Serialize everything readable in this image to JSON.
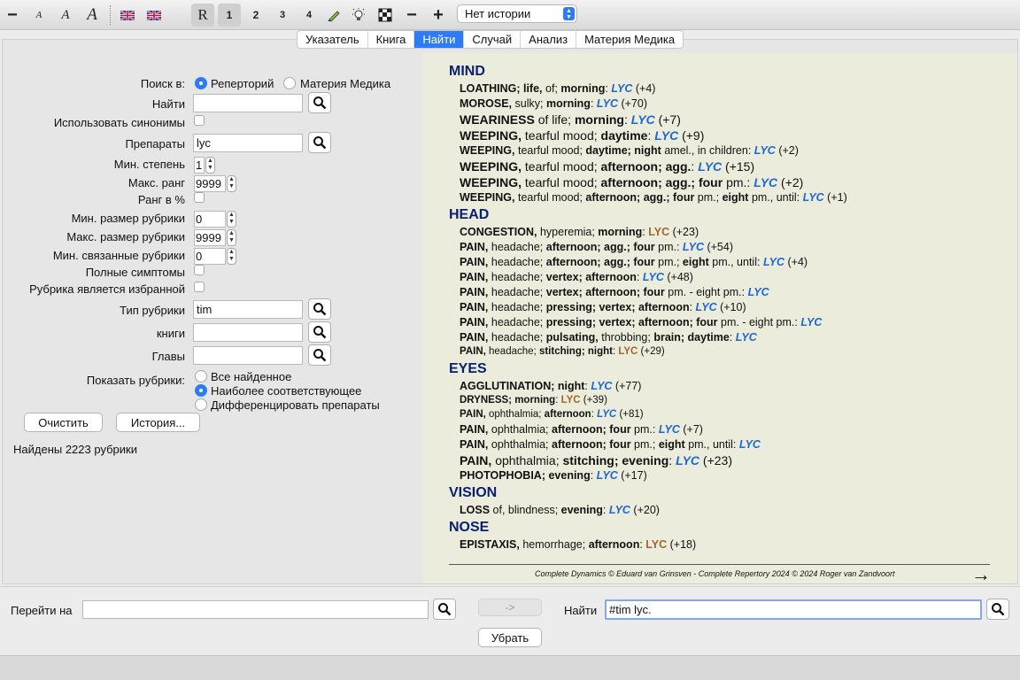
{
  "toolbar": {
    "font_buttons": [
      "−",
      "A",
      "A",
      "A"
    ],
    "rep_button": "R",
    "level_buttons": [
      "1",
      "2",
      "3",
      "4"
    ],
    "zoom_minus": "−",
    "zoom_plus": "+",
    "history_select": "Нет истории"
  },
  "tabs": [
    "Указатель",
    "Книга",
    "Найти",
    "Случай",
    "Анализ",
    "Материя Медика"
  ],
  "search_form": {
    "search_in_label": "Поиск в:",
    "search_in_options": [
      "Реперторий",
      "Материя Медика"
    ],
    "find_label": "Найти",
    "find_value": "",
    "synonyms_label": "Использовать синонимы",
    "remedies_label": "Препараты",
    "remedies_value": "lyc",
    "min_degree_label": "Мин. степень",
    "min_degree_value": "1",
    "max_rank_label": "Макс. ранг",
    "max_rank_value": "9999",
    "rank_percent_label": "Ранг в %",
    "min_rubric_size_label": "Мин. размер рубрики",
    "min_rubric_size_value": "0",
    "max_rubric_size_label": "Макс. размер рубрики",
    "max_rubric_size_value": "9999",
    "min_related_label": "Мин. связанные рубрики",
    "min_related_value": "0",
    "full_symptoms_label": "Полные симптомы",
    "favorite_label": "Рубрика является избранной",
    "rubric_type_label": "Тип рубрики",
    "rubric_type_value": "tim",
    "books_label": "книги",
    "books_value": "",
    "chapters_label": "Главы",
    "chapters_value": "",
    "show_rubrics_label": "Показать рубрики:",
    "show_options": [
      "Все найденное",
      "Наиболее соответствующее",
      "Дифференцировать препараты"
    ],
    "clear_button": "Очистить",
    "history_button": "История...",
    "status": "Найдены 2223 рубрики"
  },
  "results": {
    "chapters": [
      {
        "name": "MIND",
        "rubrics": [
          {
            "size": "normal",
            "parts": [
              [
                "b",
                "LOATHING; life, "
              ],
              [
                "",
                "of; "
              ],
              [
                "b",
                "morning"
              ],
              [
                "",
                ": "
              ],
              [
                "lyc1",
                "LYC"
              ],
              [
                "",
                " (+4)"
              ]
            ]
          },
          {
            "size": "normal",
            "parts": [
              [
                "b",
                "MOROSE, "
              ],
              [
                "",
                "sulky; "
              ],
              [
                "b",
                "morning"
              ],
              [
                "",
                ": "
              ],
              [
                "lyc1",
                "LYC"
              ],
              [
                "",
                " (+70)"
              ]
            ]
          },
          {
            "size": "big",
            "parts": [
              [
                "b",
                "WEARINESS "
              ],
              [
                "",
                "of life; "
              ],
              [
                "b",
                "morning"
              ],
              [
                "",
                ": "
              ],
              [
                "lyc1",
                "LYC"
              ],
              [
                "",
                " (+7)"
              ]
            ]
          },
          {
            "size": "big",
            "parts": [
              [
                "b",
                "WEEPING, "
              ],
              [
                "",
                "tearful mood; "
              ],
              [
                "b",
                "daytime"
              ],
              [
                "",
                ": "
              ],
              [
                "lyc1",
                "LYC"
              ],
              [
                "",
                " (+9)"
              ]
            ]
          },
          {
            "size": "normal",
            "parts": [
              [
                "b",
                "WEEPING, "
              ],
              [
                "",
                "tearful mood; "
              ],
              [
                "b",
                "daytime; night "
              ],
              [
                "",
                "amel., in children: "
              ],
              [
                "lyc1",
                "LYC"
              ],
              [
                "",
                " (+2)"
              ]
            ]
          },
          {
            "size": "big",
            "parts": [
              [
                "b",
                "WEEPING, "
              ],
              [
                "",
                "tearful mood; "
              ],
              [
                "b",
                "afternoon; agg."
              ],
              [
                "",
                ": "
              ],
              [
                "lyc1",
                "LYC"
              ],
              [
                "",
                " (+15)"
              ]
            ]
          },
          {
            "size": "big",
            "parts": [
              [
                "b",
                "WEEPING, "
              ],
              [
                "",
                "tearful mood; "
              ],
              [
                "b",
                "afternoon; agg.; four "
              ],
              [
                "",
                "pm.: "
              ],
              [
                "lyc1",
                "LYC"
              ],
              [
                "",
                " (+2)"
              ]
            ]
          },
          {
            "size": "normal",
            "parts": [
              [
                "b",
                "WEEPING, "
              ],
              [
                "",
                "tearful mood; "
              ],
              [
                "b",
                "afternoon; agg.; four "
              ],
              [
                "",
                "pm.; "
              ],
              [
                "b",
                "eight "
              ],
              [
                "",
                "pm., until: "
              ],
              [
                "lyc1",
                "LYC"
              ],
              [
                "",
                " (+1)"
              ]
            ]
          }
        ]
      },
      {
        "name": "HEAD",
        "rubrics": [
          {
            "size": "normal",
            "parts": [
              [
                "b",
                "CONGESTION, "
              ],
              [
                "",
                "hyperemia; "
              ],
              [
                "b",
                "morning"
              ],
              [
                "",
                ": "
              ],
              [
                "lyc2",
                "LYC"
              ],
              [
                "",
                " (+23)"
              ]
            ]
          },
          {
            "size": "normal",
            "parts": [
              [
                "b",
                "PAIN, "
              ],
              [
                "",
                "headache; "
              ],
              [
                "b",
                "afternoon; agg.; four "
              ],
              [
                "",
                "pm.: "
              ],
              [
                "lyc1",
                "LYC"
              ],
              [
                "",
                " (+54)"
              ]
            ]
          },
          {
            "size": "normal",
            "parts": [
              [
                "b",
                "PAIN, "
              ],
              [
                "",
                "headache; "
              ],
              [
                "b",
                "afternoon; agg.; four "
              ],
              [
                "",
                "pm.; "
              ],
              [
                "b",
                "eight "
              ],
              [
                "",
                "pm., until: "
              ],
              [
                "lyc1",
                "LYC"
              ],
              [
                "",
                " (+4)"
              ]
            ]
          },
          {
            "size": "normal",
            "parts": [
              [
                "b",
                "PAIN, "
              ],
              [
                "",
                "headache; "
              ],
              [
                "b",
                "vertex; afternoon"
              ],
              [
                "",
                ": "
              ],
              [
                "lyc1",
                "LYC"
              ],
              [
                "",
                " (+48)"
              ]
            ]
          },
          {
            "size": "normal",
            "parts": [
              [
                "b",
                "PAIN, "
              ],
              [
                "",
                "headache; "
              ],
              [
                "b",
                "vertex; afternoon; four "
              ],
              [
                "",
                "pm. - eight pm.: "
              ],
              [
                "lyc1",
                "LYC"
              ]
            ]
          },
          {
            "size": "normal",
            "parts": [
              [
                "b",
                "PAIN, "
              ],
              [
                "",
                "headache; "
              ],
              [
                "b",
                "pressing; vertex; afternoon"
              ],
              [
                "",
                ": "
              ],
              [
                "lyc1",
                "LYC"
              ],
              [
                "",
                " (+10)"
              ]
            ]
          },
          {
            "size": "normal",
            "parts": [
              [
                "b",
                "PAIN, "
              ],
              [
                "",
                "headache; "
              ],
              [
                "b",
                "pressing; vertex; afternoon; four "
              ],
              [
                "",
                "pm. - eight pm.: "
              ],
              [
                "lyc1",
                "LYC"
              ]
            ]
          },
          {
            "size": "normal",
            "parts": [
              [
                "b",
                "PAIN, "
              ],
              [
                "",
                "headache; "
              ],
              [
                "b",
                "pulsating, "
              ],
              [
                "",
                "throbbing; "
              ],
              [
                "b",
                "brain; daytime"
              ],
              [
                "",
                ": "
              ],
              [
                "lyc1",
                "LYC"
              ]
            ]
          },
          {
            "size": "small",
            "parts": [
              [
                "b",
                "PAIN, "
              ],
              [
                "",
                "headache; "
              ],
              [
                "b",
                "stitching; night"
              ],
              [
                "",
                ": "
              ],
              [
                "lyc2",
                "LYC"
              ],
              [
                "",
                " (+29)"
              ]
            ]
          }
        ]
      },
      {
        "name": "EYES",
        "rubrics": [
          {
            "size": "normal",
            "parts": [
              [
                "b",
                "AGGLUTINATION; night"
              ],
              [
                "",
                ": "
              ],
              [
                "lyc1",
                "LYC"
              ],
              [
                "",
                " (+77)"
              ]
            ]
          },
          {
            "size": "small",
            "parts": [
              [
                "b",
                "DRYNESS; morning"
              ],
              [
                "",
                ": "
              ],
              [
                "lyc2",
                "LYC"
              ],
              [
                "",
                " (+39)"
              ]
            ]
          },
          {
            "size": "small",
            "parts": [
              [
                "b",
                "PAIN, "
              ],
              [
                "",
                "ophthalmia; "
              ],
              [
                "b",
                "afternoon"
              ],
              [
                "",
                ": "
              ],
              [
                "lyc1",
                "LYC"
              ],
              [
                "",
                " (+81)"
              ]
            ]
          },
          {
            "size": "normal",
            "parts": [
              [
                "b",
                "PAIN, "
              ],
              [
                "",
                "ophthalmia; "
              ],
              [
                "b",
                "afternoon; four "
              ],
              [
                "",
                "pm.: "
              ],
              [
                "lyc1",
                "LYC"
              ],
              [
                "",
                " (+7)"
              ]
            ]
          },
          {
            "size": "normal",
            "parts": [
              [
                "b",
                "PAIN, "
              ],
              [
                "",
                "ophthalmia; "
              ],
              [
                "b",
                "afternoon; four "
              ],
              [
                "",
                "pm.; "
              ],
              [
                "b",
                "eight "
              ],
              [
                "",
                "pm., until: "
              ],
              [
                "lyc1",
                "LYC"
              ]
            ]
          },
          {
            "size": "big",
            "parts": [
              [
                "b",
                "PAIN, "
              ],
              [
                "",
                "ophthalmia; "
              ],
              [
                "b",
                "stitching; evening"
              ],
              [
                "",
                ": "
              ],
              [
                "lyc1",
                "LYC"
              ],
              [
                "",
                " (+23)"
              ]
            ]
          },
          {
            "size": "normal",
            "parts": [
              [
                "b",
                "PHOTOPHOBIA; evening"
              ],
              [
                "",
                ": "
              ],
              [
                "lyc1",
                "LYC"
              ],
              [
                "",
                " (+17)"
              ]
            ]
          }
        ]
      },
      {
        "name": "VISION",
        "rubrics": [
          {
            "size": "normal",
            "parts": [
              [
                "b",
                "LOSS "
              ],
              [
                "",
                "of, blindness; "
              ],
              [
                "b",
                "evening"
              ],
              [
                "",
                ": "
              ],
              [
                "lyc1",
                "LYC"
              ],
              [
                "",
                " (+20)"
              ]
            ]
          }
        ]
      },
      {
        "name": "NOSE",
        "rubrics": [
          {
            "size": "normal",
            "parts": [
              [
                "b",
                "EPISTAXIS, "
              ],
              [
                "",
                "hemorrhage; "
              ],
              [
                "b",
                "afternoon"
              ],
              [
                "",
                ": "
              ],
              [
                "lyc2",
                "LYC"
              ],
              [
                "",
                " (+18)"
              ]
            ]
          }
        ]
      }
    ],
    "copyright": "Complete Dynamics © Eduard van Grinsven   -   Complete Repertory 2024 © 2024 Roger van Zandvoort",
    "next_arrow": "→"
  },
  "bottom": {
    "goto_label": "Перейти на",
    "goto_value": "",
    "arrow_button": "->",
    "find_label": "Найти",
    "find_value": "#tim lyc.",
    "remove_button": "Убрать"
  },
  "colors": {
    "accent": "#2f7bf5",
    "chapter": "#0b1e70",
    "lyc_italic": "#1c68d3",
    "lyc_plain": "#a0662a",
    "results_bg": "#ececdc"
  }
}
